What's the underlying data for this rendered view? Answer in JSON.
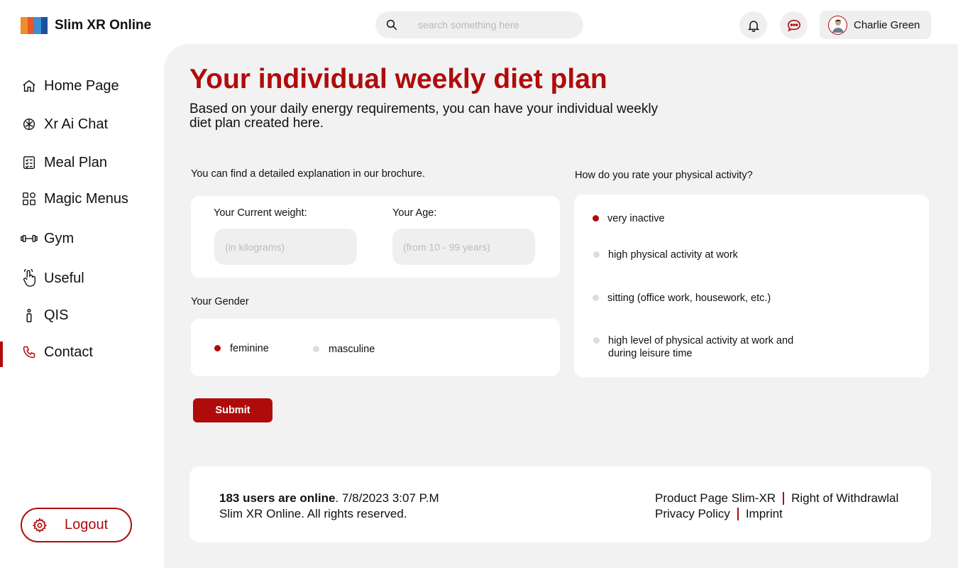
{
  "header": {
    "app_title": "Slim XR Online",
    "search_placeholder": "search something here",
    "user_name": "Charlie Green",
    "icons": [
      "search-icon",
      "bell-icon",
      "chat-icon",
      "avatar"
    ]
  },
  "sidebar": {
    "items": [
      {
        "label": "Home Page",
        "icon": "home-icon"
      },
      {
        "label": "Xr Ai Chat",
        "icon": "brain-icon"
      },
      {
        "label": "Meal Plan",
        "icon": "checklist-icon"
      },
      {
        "label": "Magic Menus",
        "icon": "grid-icon"
      },
      {
        "label": "Gym",
        "icon": "dumbbell-icon"
      },
      {
        "label": "Useful",
        "icon": "hand-pointer-icon"
      },
      {
        "label": "QIS",
        "icon": "info-icon"
      },
      {
        "label": "Contact",
        "icon": "phone-icon",
        "active": true
      }
    ],
    "logout_label": "Logout"
  },
  "main": {
    "title": "Your individual weekly diet plan",
    "subtitle": "Based on your daily energy requirements, you can have your individual weekly diet plan created here.",
    "brochure_text": "You can find a detailed explanation in our brochure.",
    "weight_label": "Your Current weight:",
    "weight_placeholder": "(in kilograms)",
    "age_label": "Your Age:",
    "age_placeholder": "(from 10 - 99 years)",
    "gender_label": "Your Gender",
    "gender_options": [
      {
        "label": "feminine",
        "selected": true
      },
      {
        "label": "masculine",
        "selected": false
      }
    ],
    "activity_question": "How do you rate your physical activity?",
    "activity_options": [
      {
        "label": "very inactive",
        "selected": true
      },
      {
        "label": "high physical activity at work",
        "selected": false
      },
      {
        "label": "sitting (office work, housework, etc.)",
        "selected": false
      },
      {
        "label": "high level of physical activity at work and during leisure time",
        "selected": false
      }
    ],
    "submit_label": "Submit"
  },
  "footer": {
    "users_online": "183 users are online",
    "datetime": ". 7/8/2023 3:07 P.M",
    "rights": "Slim XR Online. All rights reserved.",
    "links": [
      "Product Page Slim-XR",
      "Right of Withdrawlal",
      "Privacy Policy",
      "Imprint"
    ]
  },
  "colors": {
    "accent": "#b00b0b",
    "panel": "#f2f2f2",
    "input": "#efefef"
  }
}
